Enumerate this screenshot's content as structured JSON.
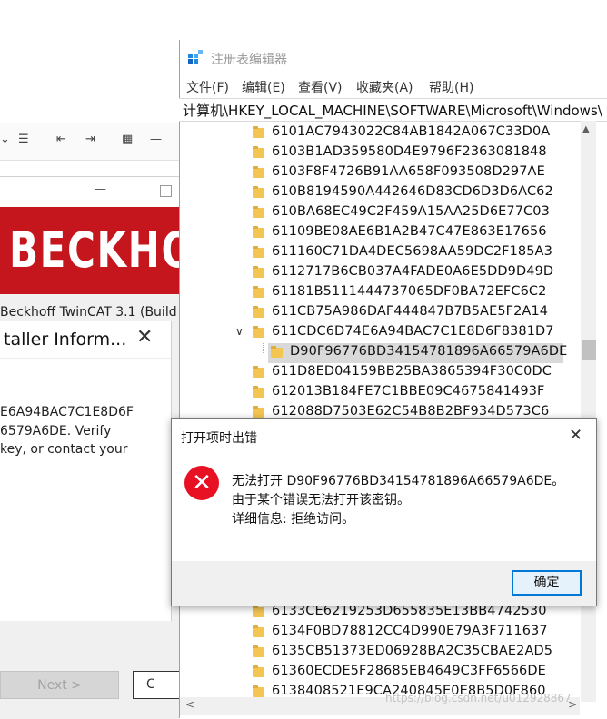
{
  "installer": {
    "product_text": "Beckhoff TwinCAT 3.1 (Build",
    "banner_text": "BECKHO",
    "message_title": "taller Inform...",
    "message_lines": [
      "E6A94BAC7C1E8D6F",
      "6579A6DE.   Verify",
      " key, or contact your"
    ],
    "next_label": "Next >",
    "cancel_label": "C"
  },
  "regedit": {
    "title": "注册表编辑器",
    "menu": [
      "文件(F)",
      "编辑(E)",
      "查看(V)",
      "收藏夹(A)",
      "帮助(H)"
    ],
    "address": "计算机\\HKEY_LOCAL_MACHINE\\SOFTWARE\\Microsoft\\Windows\\",
    "keys_top": [
      "6101AC7943022C84AB1842A067C33D0A",
      "6103B1AD359580D4E9796F2363081848",
      "6103F8F4726B91AA658F093508D297AE",
      "610B8194590A442646D83CD6D3D6AC62",
      "610BA68EC49C2F459A15AA25D6E77C03",
      "61109BE08AE6B1A2B47C47E863E17656",
      "611160C71DA4DEC5698AA59DC2F185A3",
      "6112717B6CB037A4FADE0A6E5DD9D49D",
      "61181B5111444737065DF0BA72EFC6C2",
      "611CB75A986DAF444847B7B5AE5F2A14"
    ],
    "expanded_key": "611CDC6D74E6A94BAC7C1E8D6F8381D7",
    "selected_subkey": "D90F96776BD34154781896A66579A6DE",
    "keys_after": [
      "611D8ED04159BB25BA3865394F30C0DC",
      "612013B184FE7C1BBE09C4675841493F",
      "612088D7503E62C54B8B2BF934D573C6"
    ],
    "keys_bottom": [
      "6133CE6219253D655835E13BB4742530",
      "6134F0BD78812CC4D990E79A3F711637",
      "6135CB51373ED06928BA2C35CBAE2AD5",
      "61360ECDE5F28685EB4649C3FF6566DE",
      "6138408521E9CA240845E0E8B5D0F860"
    ],
    "watermark": "https://blog.csdn.net/u012928867"
  },
  "dialog": {
    "title": "打开项时出错",
    "line1": "无法打开 D90F96776BD34154781896A66579A6DE。",
    "line2": "由于某个错误无法打开该密钥。",
    "line3": "详细信息: 拒绝访问。",
    "ok_label": "确定"
  },
  "colors": {
    "error_red": "#e81123",
    "banner_red": "#c4161c",
    "accent_blue": "#0078d7",
    "folder_yellow": "#f3c552"
  }
}
